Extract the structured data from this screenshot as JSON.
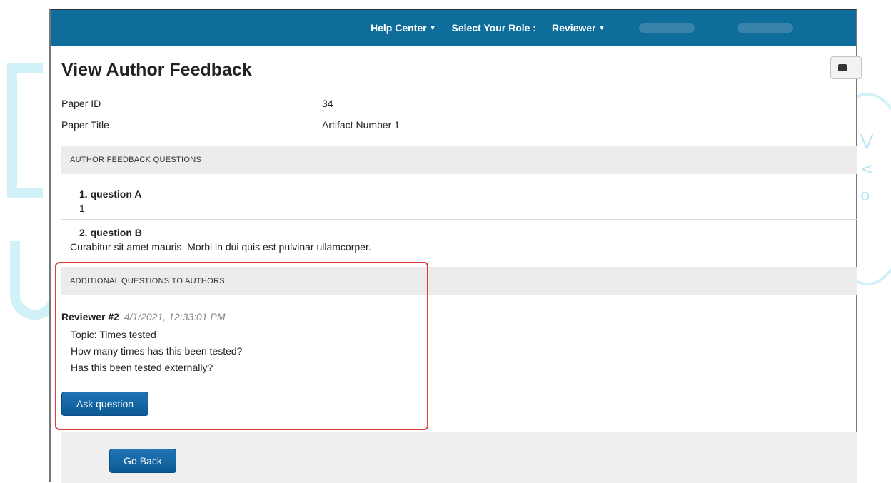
{
  "header": {
    "help_center": "Help Center",
    "select_role_label": "Select Your Role :",
    "role_value": "Reviewer"
  },
  "page": {
    "title": "View Author Feedback"
  },
  "paper": {
    "id_label": "Paper ID",
    "id_value": "34",
    "title_label": "Paper Title",
    "title_value": "Artifact Number 1"
  },
  "feedback": {
    "section_title": "AUTHOR FEEDBACK QUESTIONS",
    "questions": [
      {
        "title": "1. question A",
        "answer": "1"
      },
      {
        "title": "2. question B",
        "answer": "Curabitur sit amet mauris. Morbi in dui quis est pulvinar ullamcorper."
      }
    ]
  },
  "additional": {
    "section_title": "ADDITIONAL QUESTIONS TO AUTHORS",
    "reviewer": "Reviewer #2",
    "timestamp": "4/1/2021, 12:33:01 PM",
    "lines": [
      "Topic: Times tested",
      "How many times has this been tested?",
      "Has this been tested externally?"
    ],
    "ask_button": "Ask question"
  },
  "footer": {
    "go_back_button": "Go Back"
  },
  "colors": {
    "topbar": "#0e6d9a",
    "button": "#0c5a94",
    "highlight": "#e23b3b"
  }
}
